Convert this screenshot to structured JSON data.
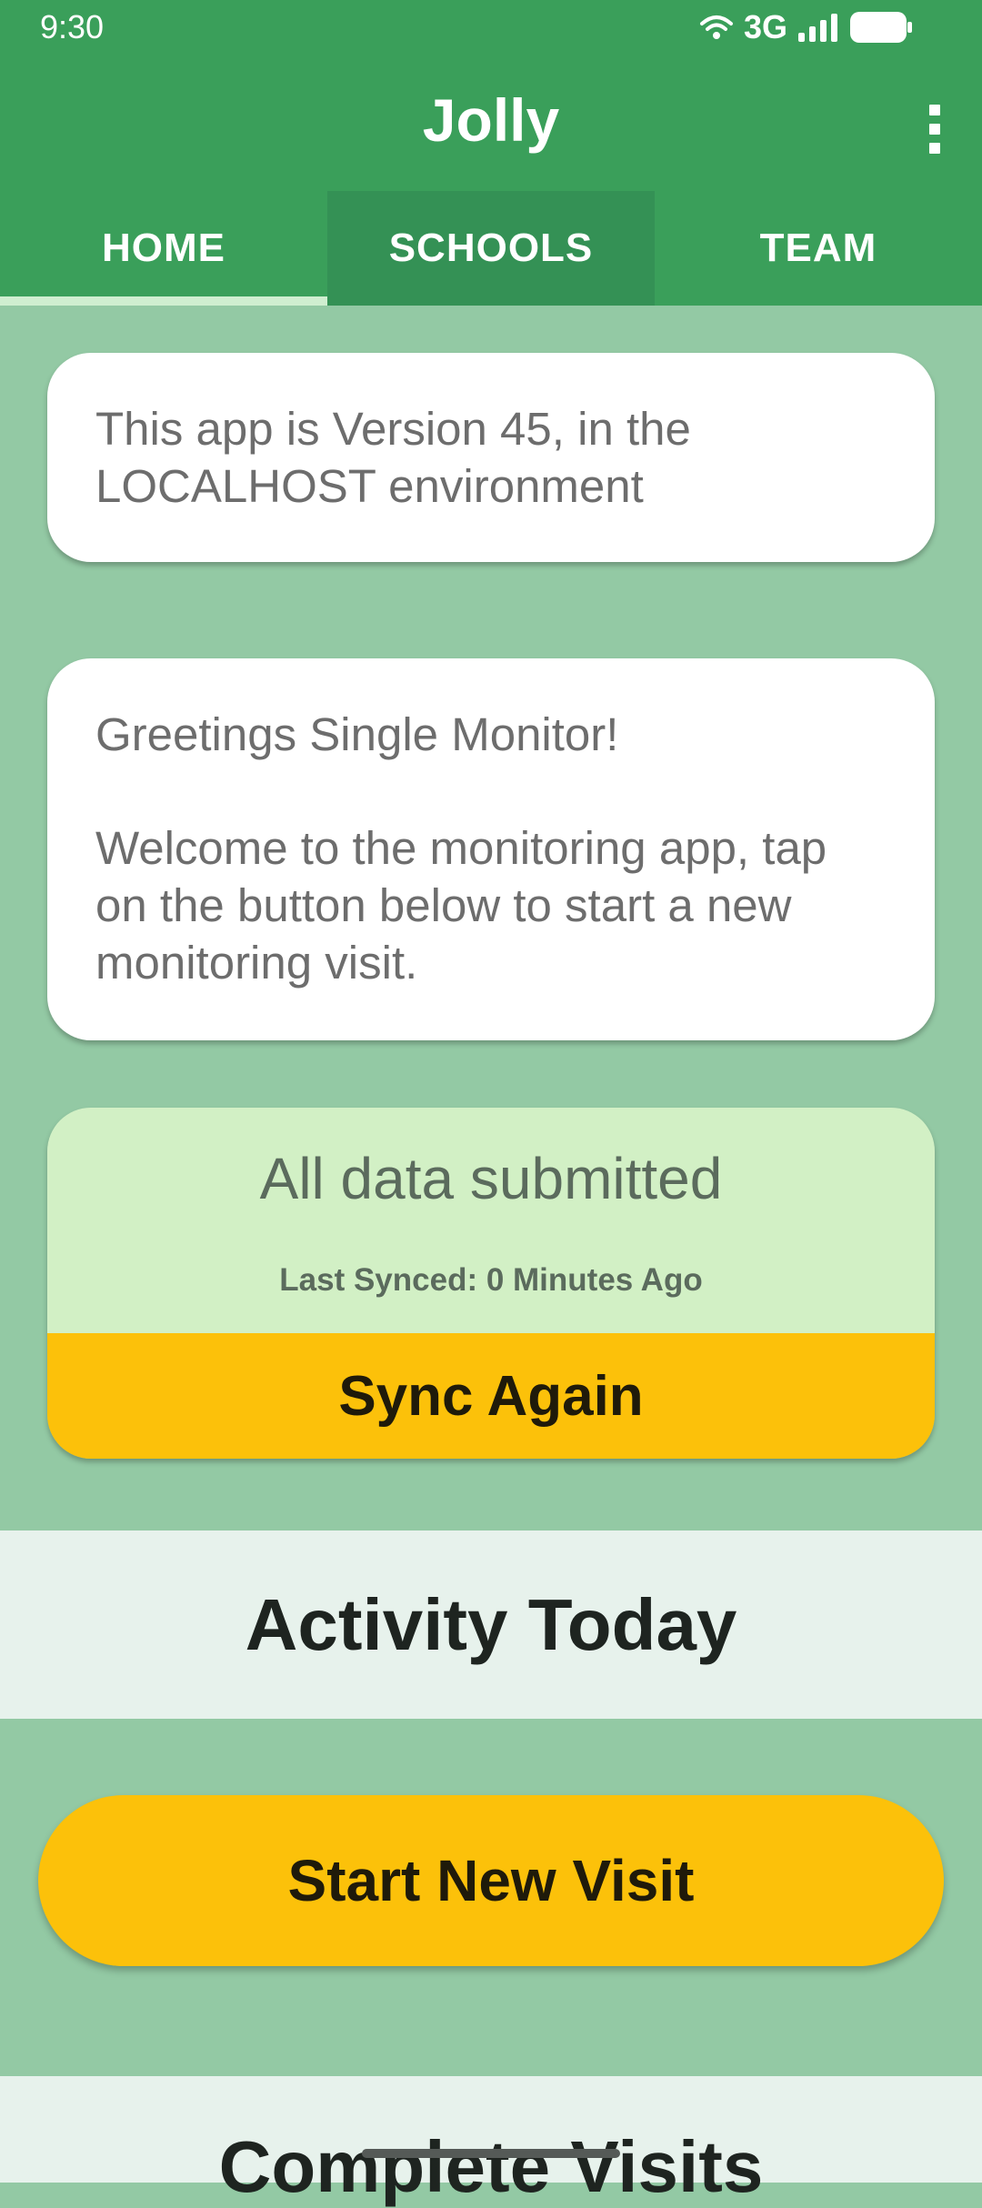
{
  "status_bar": {
    "time": "9:30",
    "network": "3G"
  },
  "app_bar": {
    "title": "Jolly",
    "menu_icon": "more-vertical-icon"
  },
  "tabs": [
    {
      "label": "HOME",
      "selected": true
    },
    {
      "label": "SCHOOLS",
      "selected": false
    },
    {
      "label": "TEAM",
      "selected": false
    }
  ],
  "version_card": {
    "text": "This app is Version 45, in the LOCALHOST environment"
  },
  "greeting_card": {
    "greeting": "Greetings Single Monitor!",
    "message": "Welcome to the monitoring app, tap on the button below to start a new monitoring visit."
  },
  "sync_card": {
    "status": "All data submitted",
    "last_synced": "Last Synced: 0 Minutes Ago",
    "button_label": "Sync Again"
  },
  "activity_section": {
    "title": "Activity Today"
  },
  "start_visit": {
    "label": "Start New Visit"
  },
  "complete_section": {
    "title": "Complete Visits"
  },
  "colors": {
    "primary": "#3a9f5a",
    "background": "#93c9a4",
    "accent": "#fcc10a",
    "sync_status_bg": "#d2f0c5"
  }
}
